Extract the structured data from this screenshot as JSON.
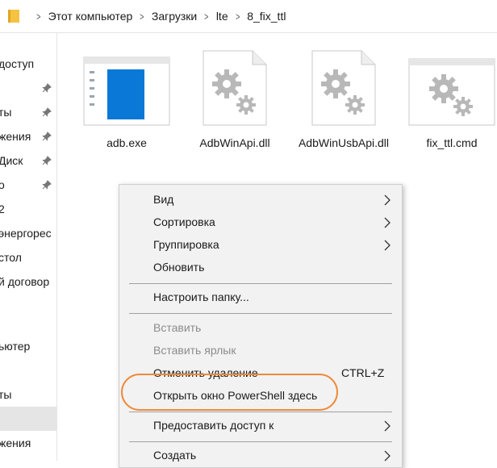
{
  "address": {
    "crumbs": [
      "Этот компьютер",
      "Загрузки",
      "lte",
      "8_fix_ttl"
    ]
  },
  "nav": {
    "items": [
      {
        "label": "доступ"
      },
      {
        "label": ""
      },
      {
        "label": "ты"
      },
      {
        "label": "жения"
      },
      {
        "label": "Диск"
      },
      {
        "label": "о"
      },
      {
        "label": "2"
      },
      {
        "label": "энергорес"
      },
      {
        "label": "стол"
      },
      {
        "label": "й договор"
      },
      {
        "label": ""
      },
      {
        "label": "ьютер"
      },
      {
        "label": ""
      },
      {
        "label": "ты"
      },
      {
        "label": ""
      },
      {
        "label": "жения"
      }
    ]
  },
  "files": [
    {
      "name": "adb.exe",
      "icon": "exe-app-icon"
    },
    {
      "name": "AdbWinApi.dll",
      "icon": "gear-file-icon"
    },
    {
      "name": "AdbWinUsbApi.dll",
      "icon": "gear-file-icon"
    },
    {
      "name": "fix_ttl.cmd",
      "icon": "gear-window-icon"
    }
  ],
  "context_menu": {
    "items": {
      "view": "Вид",
      "sort": "Сортировка",
      "group": "Группировка",
      "refresh": "Обновить",
      "customize": "Настроить папку...",
      "paste": "Вставить",
      "paste_shortcut": "Вставить ярлык",
      "undo_delete": "Отменить удаление",
      "undo_shortcut": "CTRL+Z",
      "powershell": "Открыть окно PowerShell здесь",
      "share": "Предоставить доступ к",
      "create": "Создать"
    }
  },
  "colors": {
    "highlight": "#ee8a3a",
    "exe_blue": "#0a78d7",
    "folder_yellow": "#f5c242"
  }
}
